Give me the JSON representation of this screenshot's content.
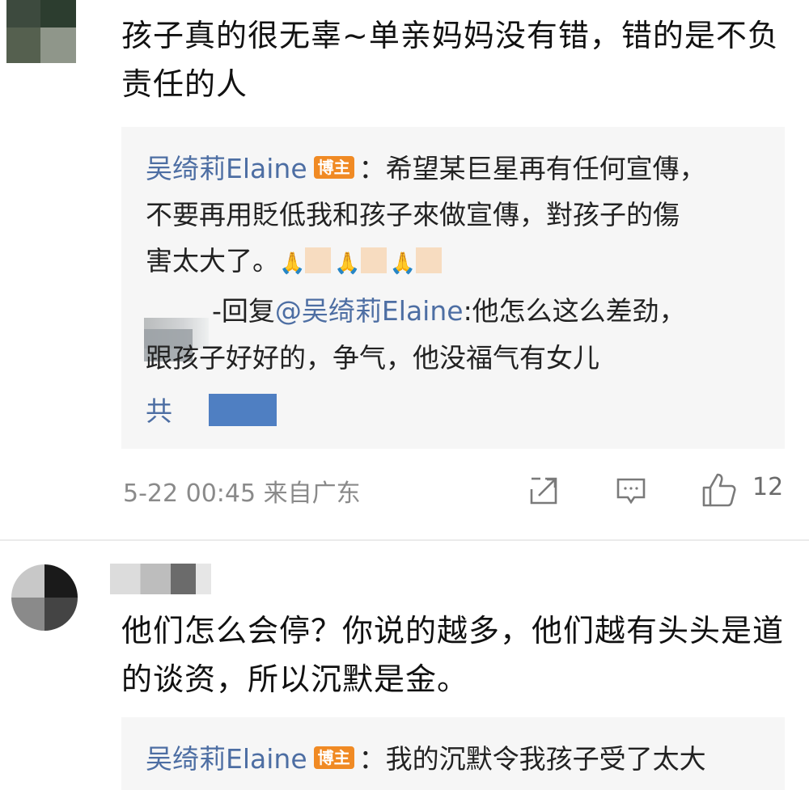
{
  "comment1": {
    "text": "孩子真的很无辜~单亲妈妈没有错，错的是不负责任的人",
    "quote": {
      "author": "吴绮莉Elaine",
      "badge": "博主",
      "line1": "：希望某巨星再有任何宣傳，",
      "line2": "不要再用貶低我和孩子來做宣傳，對孩子的傷",
      "line3": "害太大了。",
      "reply_prefix": "-回复",
      "reply_mention": "@吴绮莉Elaine",
      "reply_text1": ":他怎么这么差劲，",
      "reply_text2": "跟孩子好好的，争气，他没福气有女儿",
      "total_prefix": "共"
    },
    "meta": {
      "time_location": "5-22 00:45 来自广东",
      "like_count": "12"
    }
  },
  "comment2": {
    "text": "他们怎么会停？你说的越多，他们越有头头是道的谈资，所以沉默是金。",
    "quote": {
      "author": "吴绮莉Elaine",
      "badge": "博主",
      "line1": "：我的沉默令我孩子受了太大"
    }
  },
  "colors": {
    "link": "#4d6ea3",
    "badge": "#f08a24",
    "meta": "#8a8a8a"
  }
}
